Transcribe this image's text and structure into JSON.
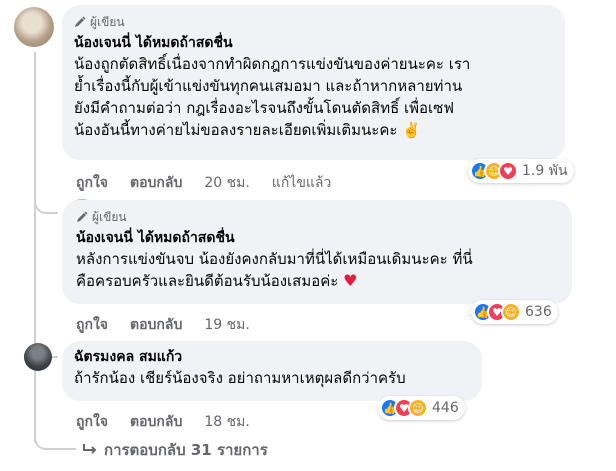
{
  "comments": [
    {
      "badge": "ผู้เขียน",
      "author": "น้องเจนนี่ ได้หมดถ้าสดชื่น",
      "text": "น้องถูกตัดสิทธิ์เนื่องจากทำผิดกฎการแข่งขันของค่ายนะคะ เรา\nย้ำเรื่องนี้กับผู้เข้าแข่งขันทุกคนเสมอมา และถ้าหากหลายท่าน\nยังมีคำถามต่อว่า กฎเรื่องอะไรจนถึงขั้นโดนตัดสิทธิ์ เพื่อเซฟ\nน้องอันนี้ทางค่ายไม่ขอลงรายละเอียดเพิ่มเติมนะคะ ✌️",
      "like": "ถูกใจ",
      "reply": "ตอบกลับ",
      "time": "20 ชม.",
      "edited": "แก้ไขแล้ว",
      "reaction_count": "1.9 พัน"
    },
    {
      "badge": "ผู้เขียน",
      "author": "น้องเจนนี่ ได้หมดถ้าสดชื่น",
      "text": "หลังการแข่งขันจบ น้องยังคงกลับมาที่นี่ได้เหมือนเดิมนะคะ ที่นี่\nคือครอบครัวและยินดีต้อนรับน้องเสมอค่ะ",
      "heart": "♥",
      "like": "ถูกใจ",
      "reply": "ตอบกลับ",
      "time": "19 ชม.",
      "reaction_count": "636"
    },
    {
      "author": "ฉัตรมงคล สมแก้ว",
      "text": "ถ้ารักน้อง เชียร์น้องจริง อย่าถามหาเหตุผลดีกว่าครับ",
      "like": "ถูกใจ",
      "reply": "ตอบกลับ",
      "time": "18 ชม.",
      "reaction_count": "446"
    }
  ],
  "view_replies": "การตอบกลับ 31 รายการ",
  "colors": {
    "bubble": "#f0f2f5",
    "meta": "#65676b",
    "like": "#1877f2",
    "love": "#f33e58",
    "care": "#f7b125"
  },
  "icons": [
    "author-pen-icon",
    "like-reaction-icon",
    "love-reaction-icon",
    "care-reaction-icon",
    "reply-arrow-icon"
  ]
}
